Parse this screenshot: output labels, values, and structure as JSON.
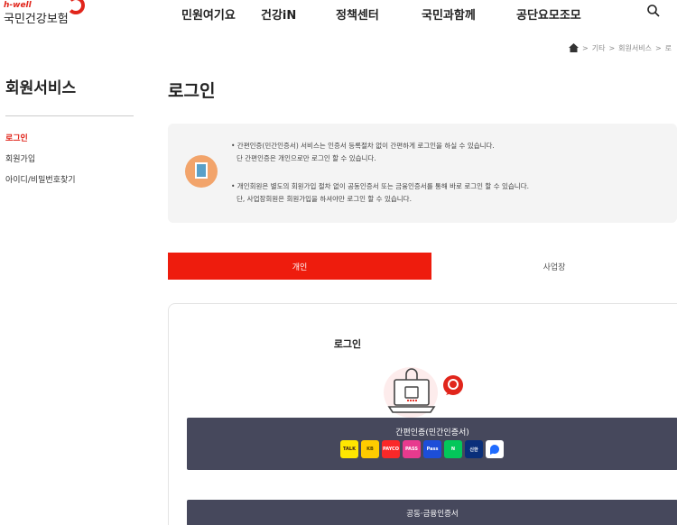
{
  "header": {
    "logo_sub": "h-well",
    "logo_main": "국민건강보험",
    "nav": [
      "민원여기요",
      "건강iN",
      "정책센터",
      "국민과함께",
      "공단요모조모"
    ]
  },
  "breadcrumb": [
    "기타",
    "회원서비스",
    "로"
  ],
  "sidebar": {
    "title": "회원서비스",
    "items": [
      {
        "label": "로그인"
      },
      {
        "label": "회원가입"
      },
      {
        "label": "아이디/비밀번호찾기"
      }
    ]
  },
  "main": {
    "title": "로그인",
    "notice": [
      "• 간편인증(민간인증서) 서비스는 인증서 등록절차 없이 간편하게 로그인을 하실 수 있습니다.",
      "단 간편인증은 개인으로만 로그인 할 수 있습니다.",
      "• 개인회원은 별도의 회원가입 절차 없이 공동인증서 또는 금융인증서를 통해 바로 로그인 할 수 있습니다.",
      "단, 사업장회원은 회원가입을 하셔야만 로그인 할 수 있습니다."
    ],
    "tabs": [
      "개인",
      "사업장"
    ],
    "login_heading": "로그인",
    "simple_auth_label": "간편인증(민간인증서)",
    "cert_label": "공동·금융인증서",
    "auth_providers": [
      {
        "name": "kakao-icon",
        "text": "TALK",
        "color": "#ffe600",
        "fg": "#3a1d1d"
      },
      {
        "name": "toss-icon",
        "text": "KB",
        "color": "#ffcc00",
        "fg": "#554400"
      },
      {
        "name": "payco-icon",
        "text": "PAYCO",
        "color": "#fa2828",
        "fg": "#ffffff"
      },
      {
        "name": "pass-icon",
        "text": "PASS",
        "color": "#e83a8e",
        "fg": "#ffffff"
      },
      {
        "name": "samsung-pass-icon",
        "text": "Pass",
        "color": "#1d4ed8",
        "fg": "#ffffff"
      },
      {
        "name": "naver-icon",
        "text": "N",
        "color": "#03c75a",
        "fg": "#ffffff"
      },
      {
        "name": "shinhan-icon",
        "text": "신한",
        "color": "#0a2f7a",
        "fg": "#ffffff"
      },
      {
        "name": "bank-salad-icon",
        "text": "",
        "color": "#ffffff",
        "fg": "#1f6bff"
      }
    ]
  },
  "colors": {
    "accent": "#e1251b",
    "tab_active": "#ee1c0d",
    "button_dark": "#46485c"
  }
}
